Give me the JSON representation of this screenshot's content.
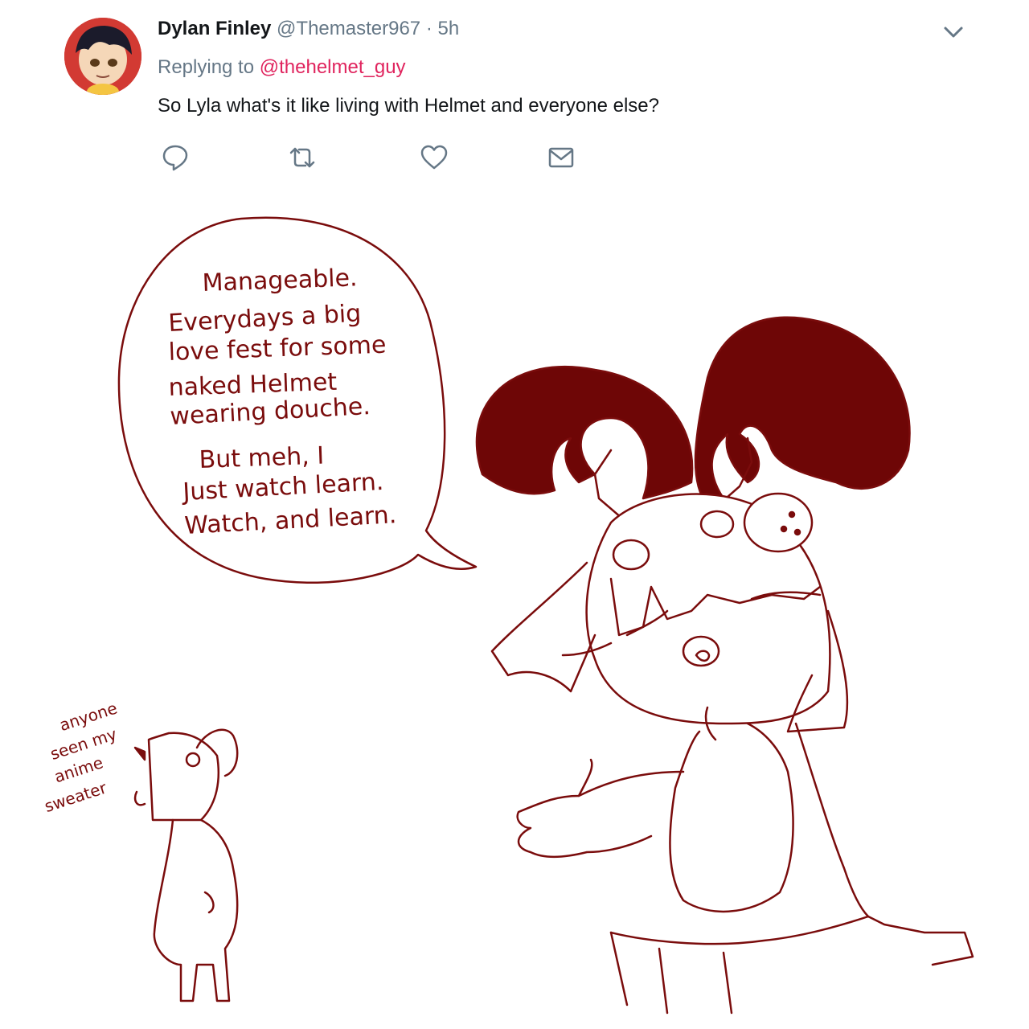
{
  "tweet": {
    "display_name": "Dylan Finley",
    "handle": "@Themaster967",
    "separator": "·",
    "time": "5h",
    "replying_prefix": "Replying to",
    "replying_to": "@thehelmet_guy",
    "text": "So Lyla what's it like living with Helmet and everyone else?"
  },
  "actions": [
    {
      "name": "reply",
      "icon": "comment-icon"
    },
    {
      "name": "retweet",
      "icon": "retweet-icon"
    },
    {
      "name": "like",
      "icon": "heart-icon"
    },
    {
      "name": "message",
      "icon": "envelope-icon"
    }
  ],
  "comic": {
    "speech_lines": [
      "Manageable.",
      "Everydays a big",
      "love fest for some",
      "naked Helmet",
      "wearing douche.",
      "But meh, I",
      "Just watch learn.",
      "Watch, and learn."
    ],
    "side_lines": [
      "anyone",
      "seen my",
      "anime",
      "sweater"
    ]
  },
  "colors": {
    "ink": "#7a0c0c",
    "link": "#e0245e",
    "muted": "#657786",
    "text": "#14171a"
  }
}
